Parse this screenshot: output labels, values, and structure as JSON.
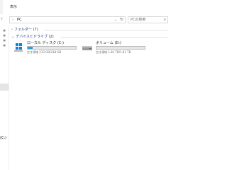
{
  "ribbon": {
    "tab_view": "表示"
  },
  "address": {
    "location": "PC",
    "search_placeholder": "PCの検索"
  },
  "nav_pane": {
    "bottom_label": "(C:)"
  },
  "groups": {
    "folders": {
      "label": "フォルダー (7)",
      "expanded": false
    },
    "devices": {
      "label": "デバイスとドライブ (2)",
      "expanded": true
    }
  },
  "drives": [
    {
      "name": "ローカル ディスク (C:)",
      "space": "空き領域 213 GB/238 GB",
      "used_fraction": 0.1,
      "icon": "windows-drive-icon"
    },
    {
      "name": "ボリューム (D:)",
      "space": "空き領域 1.81 TB/1.81 TB",
      "used_fraction": 0.0,
      "icon": "drive-icon"
    }
  ],
  "colors": {
    "accent": "#26a0da",
    "group_header": "#1e3287",
    "windows_logo": "#0a84d6"
  }
}
